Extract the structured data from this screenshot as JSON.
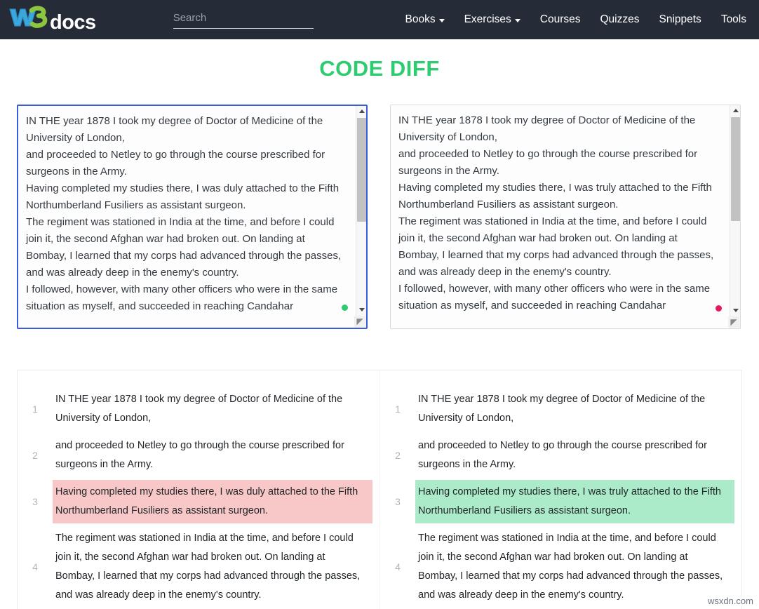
{
  "navbar": {
    "logo": {
      "w": "W",
      "three": "3",
      "docs": "docs",
      "colors": {
        "w": "#3ba7dd",
        "three": "#8cc63f",
        "docs": "#ffffff"
      }
    },
    "search": {
      "placeholder": "Search",
      "value": ""
    },
    "links": [
      {
        "label": "Books",
        "has_caret": true
      },
      {
        "label": "Exercises",
        "has_caret": true
      },
      {
        "label": "Courses",
        "has_caret": false
      },
      {
        "label": "Quizzes",
        "has_caret": false
      },
      {
        "label": "Snippets",
        "has_caret": false
      },
      {
        "label": "Tools",
        "has_caret": false
      }
    ],
    "background": "#262b38"
  },
  "page": {
    "title": "CODE DIFF",
    "title_color": "#2ecc71"
  },
  "editors": {
    "left": {
      "value": "IN THE year 1878 I took my degree of Doctor of Medicine of the University of London,\nand proceeded to Netley to go through the course prescribed for surgeons in the Army.\nHaving completed my studies there, I was duly attached to the Fifth Northumberland Fusiliers as assistant surgeon.\nThe regiment was stationed in India at the time, and before I could join it, the second Afghan war had broken out. On landing at Bombay, I learned that my corps had advanced through the passes, and was already deep in the enemy's country.\nI followed, however, with many other officers who were in the same situation as myself, and succeeded in reaching Candahar",
      "focused": true,
      "status_dot_color": "#2ecc71",
      "border_color": "#3b5bdb",
      "resize_glyph": "◥"
    },
    "right": {
      "value": "IN THE year 1878 I took my degree of Doctor of Medicine of the University of London,\nand proceeded to Netley to go through the course prescribed for surgeons in the Army.\nHaving completed my studies there, I was truly attached to the Fifth Northumberland Fusiliers as assistant surgeon.\nThe regiment was stationed in India at the time, and before I could join it, the second Afghan war had broken out. On landing at Bombay, I learned that my corps had advanced through the passes, and was already deep in the enemy's country.\nI followed, however, with many other officers who were in the same situation as myself, and succeeded in reaching Candahar",
      "focused": false,
      "status_dot_color": "#e8195a",
      "border_color": "#d8dade",
      "resize_glyph": "◥"
    }
  },
  "diff": {
    "colors": {
      "deleted_bg": "#f8c8c8",
      "inserted_bg": "#abebc9"
    },
    "left_rows": [
      {
        "line": "1",
        "text": "IN THE year 1878 I took my degree of Doctor of Medicine of the University of London,",
        "type": "equal"
      },
      {
        "line": "2",
        "text": "and proceeded to Netley to go through the course prescribed for surgeons in the Army.",
        "type": "equal"
      },
      {
        "line": "3",
        "text": "Having completed my studies there, I was duly attached to the Fifth Northumberland Fusiliers as assistant surgeon.",
        "type": "deleted"
      },
      {
        "line": "4",
        "text": "The regiment was stationed in India at the time, and before I could join it, the second Afghan war had broken out. On landing at Bombay, I learned that my corps had advanced through the passes, and was already deep in the enemy's country.",
        "type": "equal"
      }
    ],
    "right_rows": [
      {
        "line": "1",
        "text": "IN THE year 1878 I took my degree of Doctor of Medicine of the University of London,",
        "type": "equal"
      },
      {
        "line": "2",
        "text": "and proceeded to Netley to go through the course prescribed for surgeons in the Army.",
        "type": "equal"
      },
      {
        "line": "3",
        "text": "Having completed my studies there, I was truly attached to the Fifth Northumberland Fusiliers as assistant surgeon.",
        "type": "inserted"
      },
      {
        "line": "4",
        "text": "The regiment was stationed in India at the time, and before I could join it, the second Afghan war had broken out. On landing at Bombay, I learned that my corps had advanced through the passes, and was already deep in the enemy's country.",
        "type": "equal"
      }
    ]
  },
  "watermark": {
    "text": "wsxdn.com"
  }
}
